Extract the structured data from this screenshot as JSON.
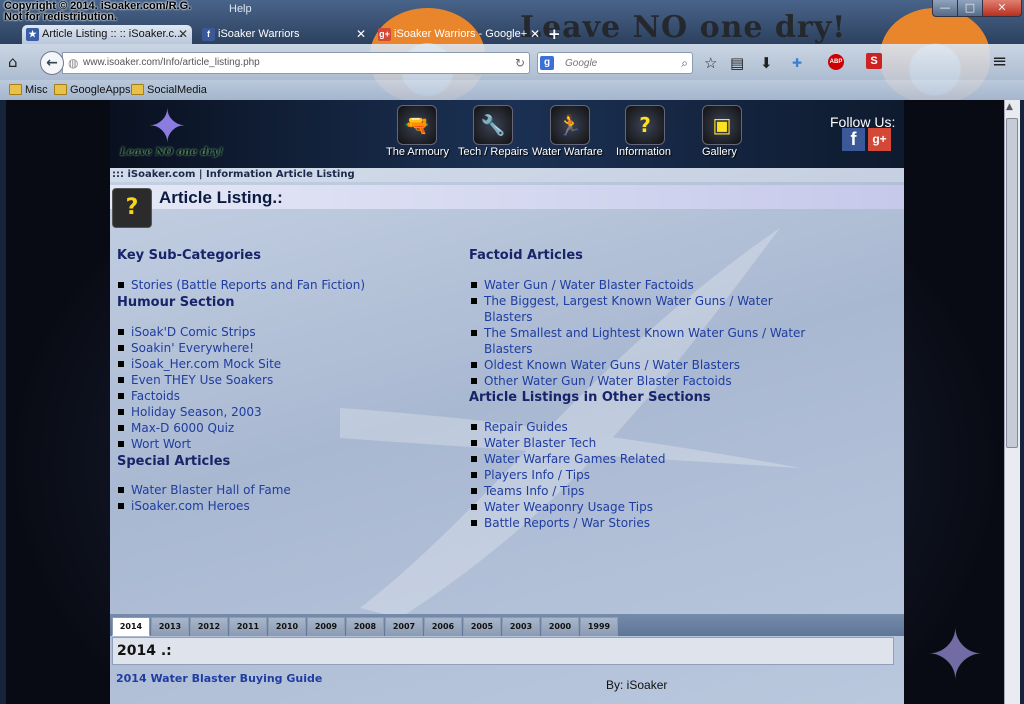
{
  "copyright": [
    "Copyright © 2014. iSoaker.com/R.G.",
    "Not for redistribution."
  ],
  "menu": {
    "help": "Help"
  },
  "window_controls": {
    "minimize": "—",
    "maximize": "□",
    "close": "✕"
  },
  "browser_banner": {
    "title": "Leave NO one dry!"
  },
  "tabs": [
    {
      "label": "Article Listing :: :: iSoaker.c...",
      "icon_text": "★",
      "icon_color": "#3a5da8"
    },
    {
      "label": "iSoaker Warriors",
      "icon_text": "f",
      "icon_color": "#3b5998"
    },
    {
      "label": "iSoaker Warriors - Google+",
      "icon_text": "g+",
      "icon_color": "#d34836"
    }
  ],
  "tab_close": "✕",
  "new_tab": "+",
  "navbar": {
    "home": "⌂",
    "back": "←",
    "url": "www.isoaker.com/Info/article_listing.php",
    "reload": "↻",
    "search_engine": "g",
    "search_placeholder": "Google",
    "search_go": "⌕",
    "star": "☆",
    "reader": "▤",
    "download": "⬇",
    "pocket": "✚",
    "abp": "ABP",
    "s_ext": "S",
    "menu": "≡"
  },
  "bookmarks": [
    "Misc",
    "GoogleApps",
    "SocialMedia"
  ],
  "site": {
    "logo": "Leave NO one dry!",
    "nav": [
      {
        "label": "The Armoury",
        "icon": "🔫"
      },
      {
        "label": "Tech / Repairs",
        "icon": "🔧"
      },
      {
        "label": "Water Warfare",
        "icon": "🏃"
      },
      {
        "label": "Information",
        "icon": "?"
      },
      {
        "label": "Gallery",
        "icon": "▣"
      }
    ],
    "follow": "Follow Us:",
    "facebook": "f",
    "googleplus": "g+"
  },
  "breadcrumb": "::: iSoaker.com | Information Article Listing",
  "info_icon": "?",
  "page_title": "Article Listing.:",
  "sections": {
    "key": {
      "title": "Key Sub-Categories",
      "items": [
        "Stories (Battle Reports and Fan Fiction)"
      ]
    },
    "humour": {
      "title": "Humour Section",
      "items": [
        "iSoak'D Comic Strips",
        "Soakin' Everywhere!",
        "iSoak_Her.com Mock Site",
        "Even THEY Use Soakers",
        "Factoids",
        "Holiday Season, 2003",
        "Max-D 6000 Quiz",
        "Wort Wort"
      ]
    },
    "special": {
      "title": "Special Articles",
      "items": [
        "Water Blaster Hall of Fame",
        "iSoaker.com Heroes"
      ]
    },
    "factoid": {
      "title": "Factoid Articles",
      "items": [
        "Water Gun / Water Blaster Factoids",
        "The Biggest, Largest Known Water Guns / Water Blasters",
        "The Smallest and Lightest Known Water Guns / Water Blasters",
        "Oldest Known Water Guns / Water Blasters",
        "Other Water Gun / Water Blaster Factoids"
      ]
    },
    "other": {
      "title": "Article Listings in Other Sections",
      "items": [
        "Repair Guides",
        "Water Blaster Tech",
        "Water Warfare Games Related",
        "Players Info / Tips",
        "Teams Info / Tips",
        "Water Weaponry Usage Tips",
        "Battle Reports / War Stories"
      ]
    }
  },
  "years": [
    "2014",
    "2013",
    "2012",
    "2011",
    "2010",
    "2009",
    "2008",
    "2007",
    "2006",
    "2005",
    "2003",
    "2000",
    "1999"
  ],
  "year_panel": {
    "heading": "2014 .:",
    "article": "2014 Water Blaster Buying Guide",
    "author": "By: iSoaker"
  },
  "scroll_up": "▲"
}
